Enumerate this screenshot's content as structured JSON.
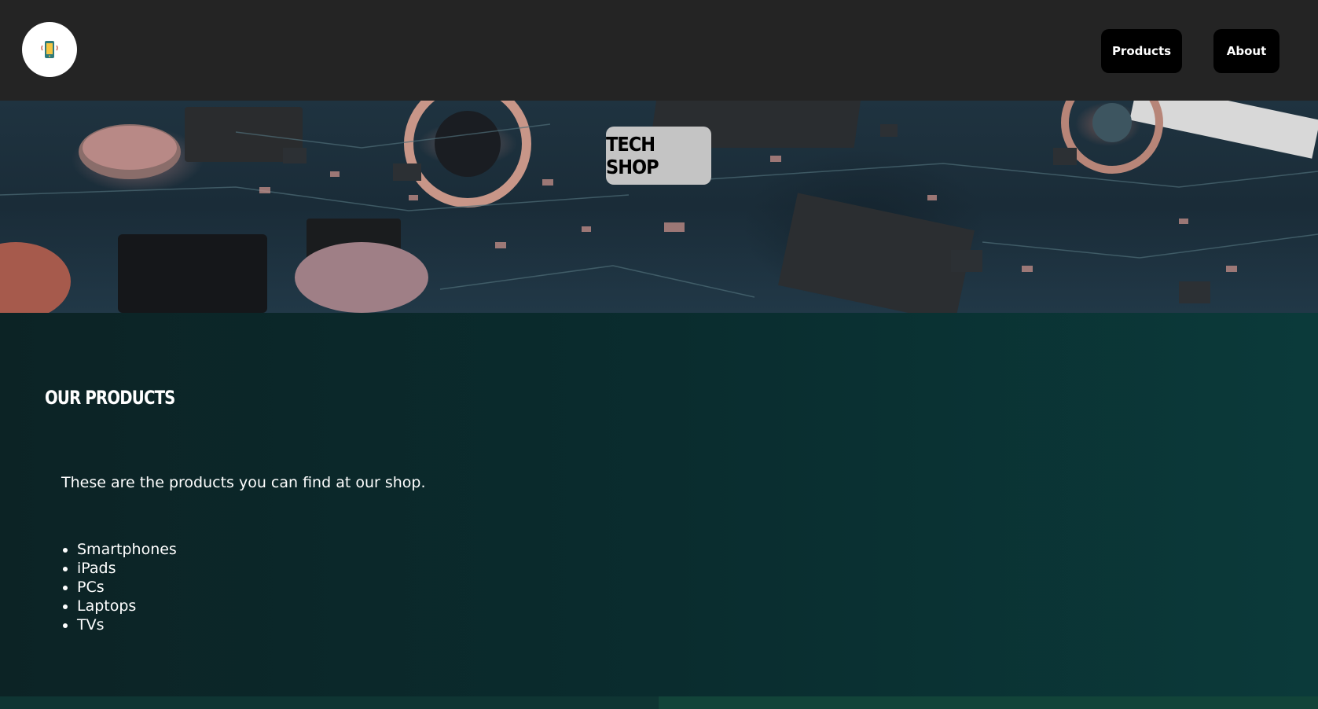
{
  "header": {
    "logo_icon": "smartphone-icon",
    "nav": {
      "products_label": "Products",
      "about_label": "About"
    }
  },
  "hero": {
    "title": "TECH SHOP",
    "background": "circuit-board-photo"
  },
  "main": {
    "section_title": "OUR PRODUCTS",
    "intro": "These are the products you can find at our shop.",
    "products": [
      "Smartphones",
      "iPads",
      "PCs",
      "Laptops",
      "TVs"
    ]
  },
  "colors": {
    "header_bg": "#242424",
    "nav_button_bg": "#000000",
    "hero_title_bg": "#c4c4c4",
    "main_bg": "#0a2c2e",
    "text": "#ffffff"
  }
}
